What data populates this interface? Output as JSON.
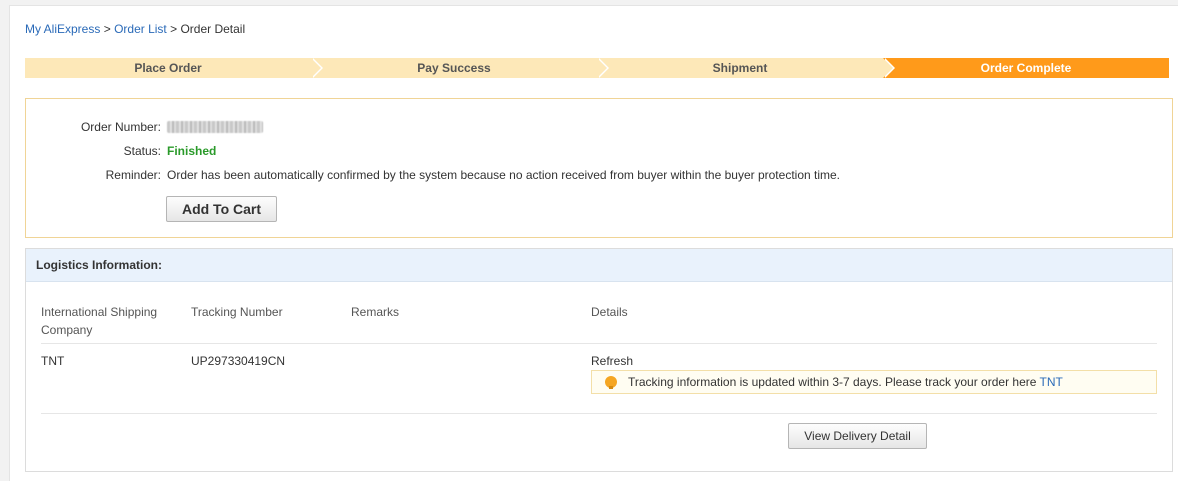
{
  "breadcrumb": {
    "items": [
      {
        "label": "My AliExpress"
      },
      {
        "label": "Order List"
      },
      {
        "label": "Order Detail"
      }
    ],
    "separator": ">"
  },
  "steps": [
    {
      "label": "Place Order",
      "active": false
    },
    {
      "label": "Pay Success",
      "active": false
    },
    {
      "label": "Shipment",
      "active": false
    },
    {
      "label": "Order Complete",
      "active": true
    }
  ],
  "order": {
    "number_label": "Order Number:",
    "status_label": "Status:",
    "status_value": "Finished",
    "reminder_label": "Reminder:",
    "reminder_value": "Order has been automatically confirmed by the system because no action received from buyer within the buyer protection time.",
    "add_to_cart_label": "Add To Cart"
  },
  "logistics": {
    "title": "Logistics Information:",
    "columns": {
      "company_line1": "International Shipping",
      "company_line2": "Company",
      "tracking": "Tracking Number",
      "remarks": "Remarks",
      "details": "Details"
    },
    "row": {
      "company": "TNT",
      "tracking_number": "UP297330419CN",
      "remarks": "",
      "refresh_label": "Refresh"
    },
    "tip_text": "Tracking information is updated within 3-7 days. Please track your order here",
    "tip_link": "TNT",
    "view_delivery_label": "View Delivery Detail"
  },
  "colors": {
    "accent": "#ff9a1a",
    "step_inactive": "#fde8b8",
    "link": "#2a6ab8",
    "status_finished": "#2a9a2a"
  },
  "icons": [
    "lightbulb-icon"
  ]
}
